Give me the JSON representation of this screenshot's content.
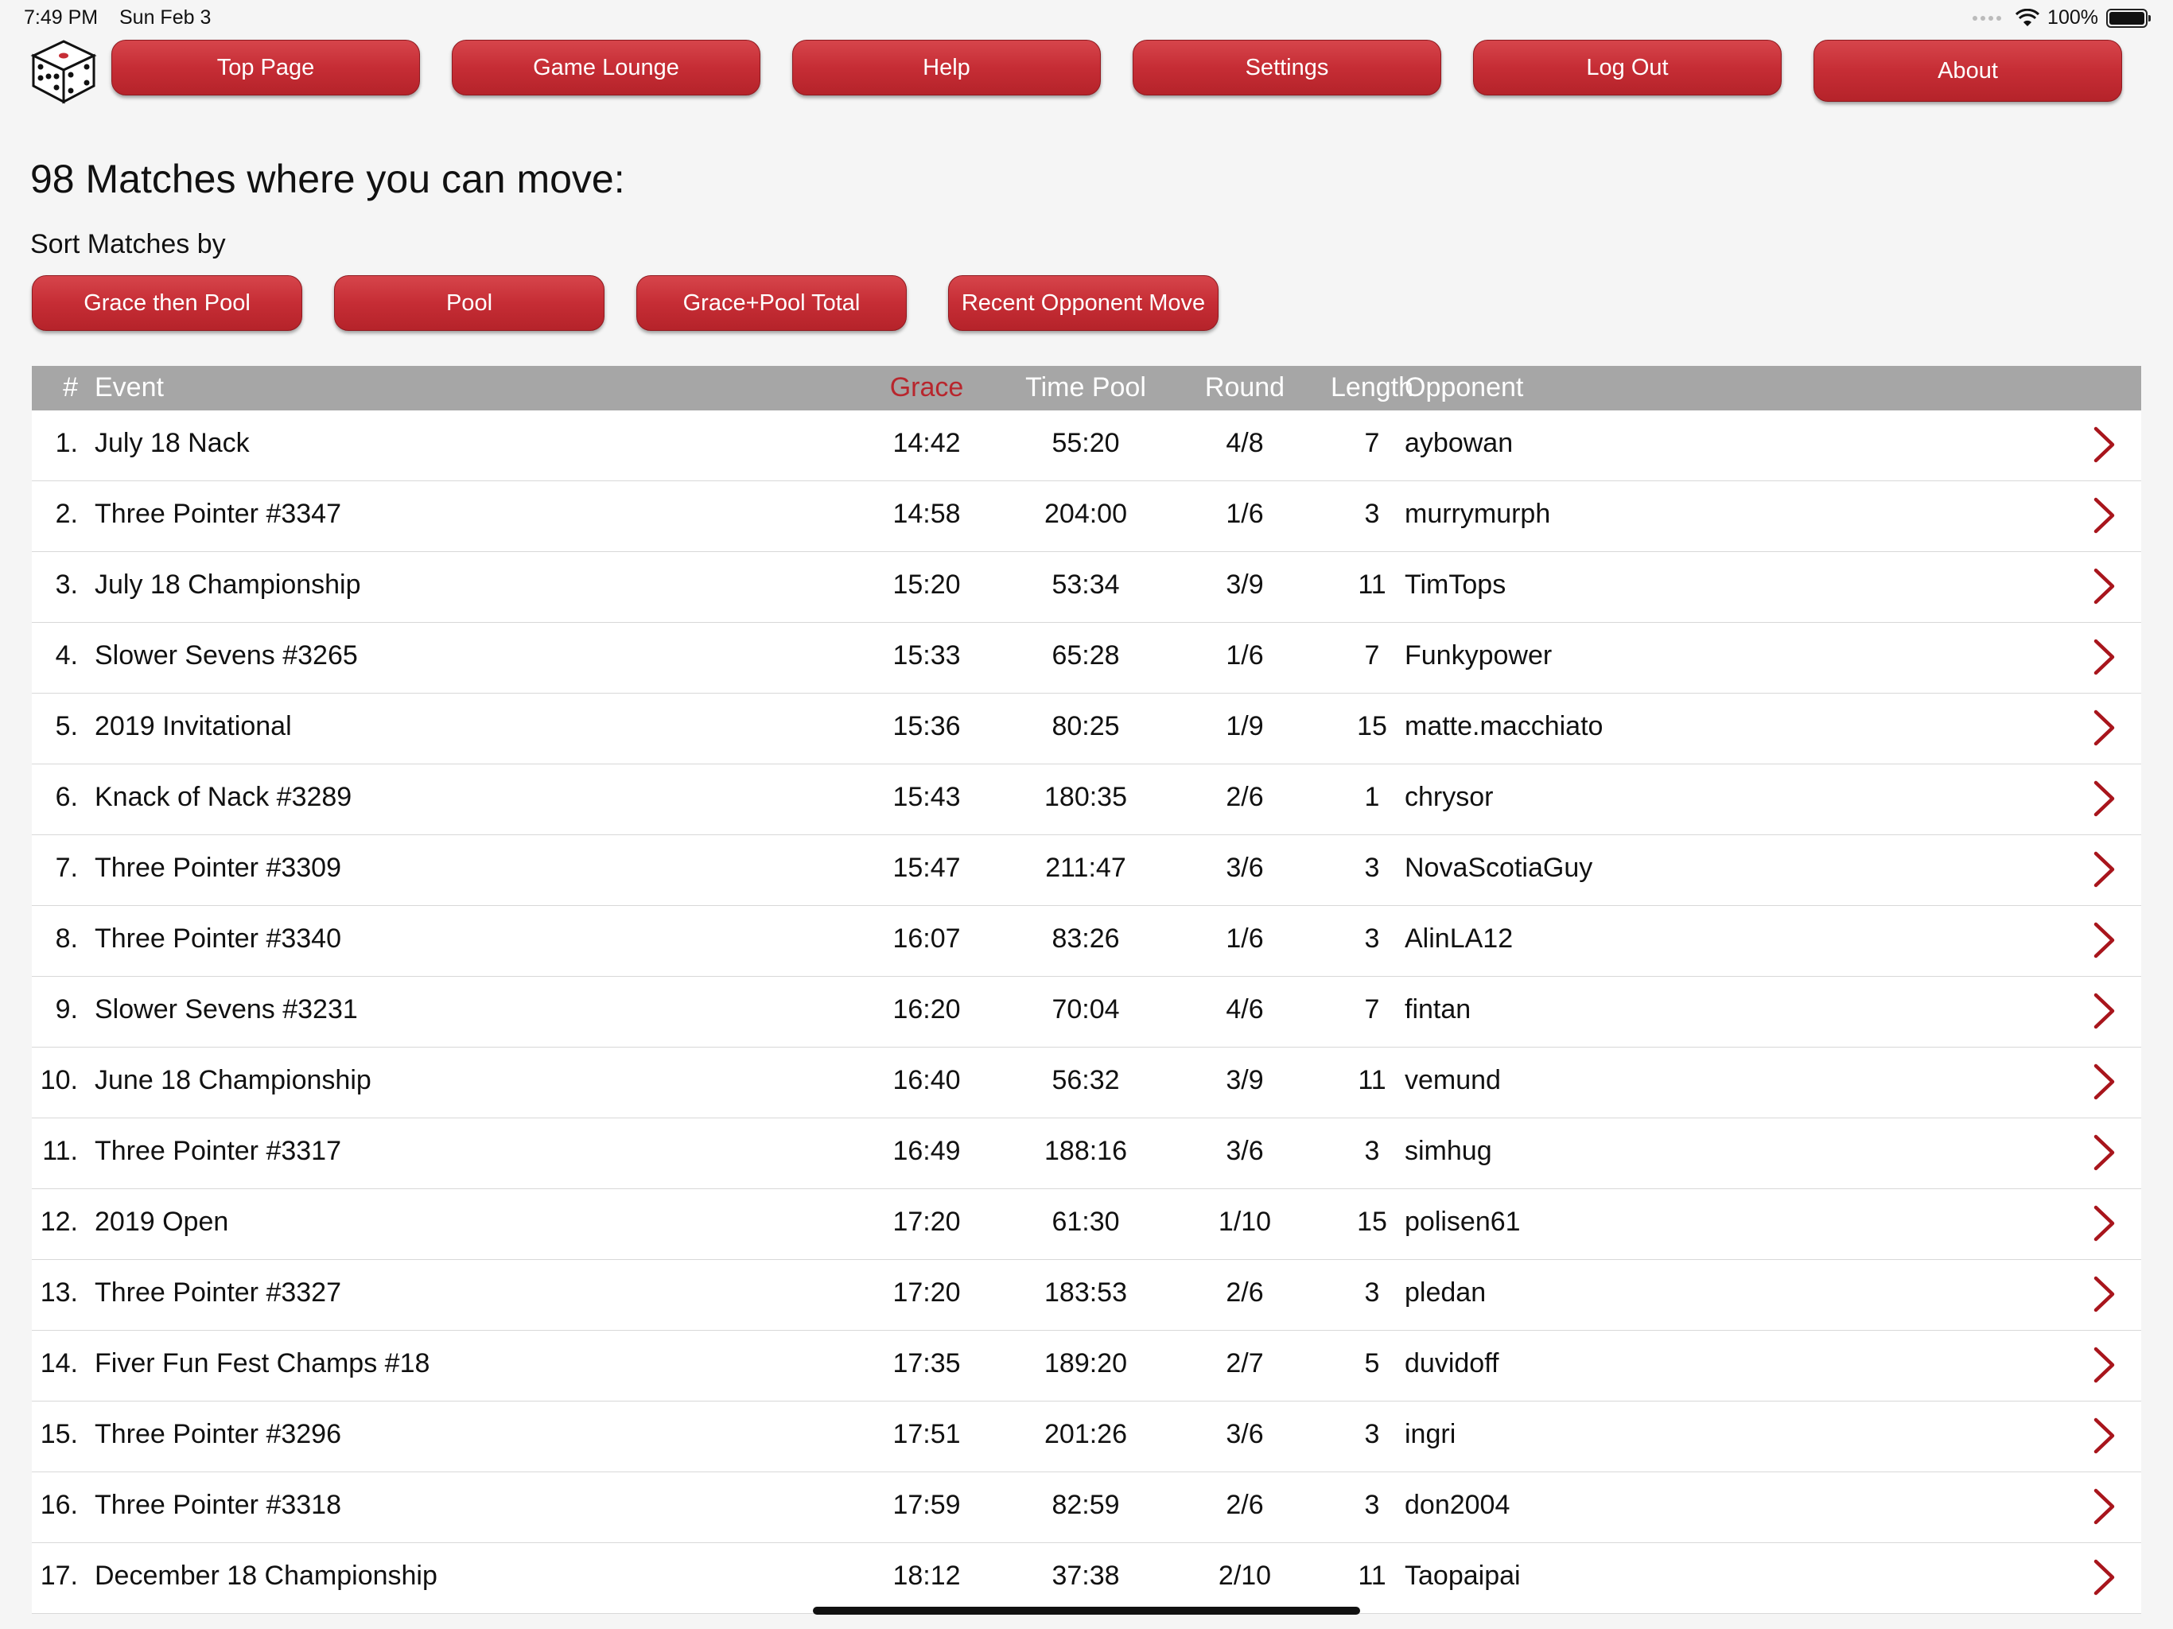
{
  "status": {
    "time": "7:49 PM",
    "date": "Sun Feb 3",
    "battery": "100%"
  },
  "nav": [
    {
      "label": "Top Page"
    },
    {
      "label": "Game Lounge"
    },
    {
      "label": "Help"
    },
    {
      "label": "Settings"
    },
    {
      "label": "Log Out"
    },
    {
      "label": "About"
    }
  ],
  "page": {
    "title": "98 Matches where you can move:",
    "sort_label": "Sort Matches by"
  },
  "sort_buttons": [
    {
      "label": "Grace then Pool"
    },
    {
      "label": "Pool"
    },
    {
      "label": "Grace+Pool Total"
    },
    {
      "label": "Recent Opponent Move"
    }
  ],
  "table": {
    "headers": {
      "num": "#",
      "event": "Event",
      "grace": "Grace",
      "pool": "Time Pool",
      "round": "Round",
      "length": "Length",
      "opponent": "Opponent"
    },
    "rows": [
      {
        "num": "1.",
        "event": "July 18 Nack",
        "grace": "14:42",
        "pool": "55:20",
        "round": "4/8",
        "length": "7",
        "opponent": "aybowan"
      },
      {
        "num": "2.",
        "event": "Three Pointer #3347",
        "grace": "14:58",
        "pool": "204:00",
        "round": "1/6",
        "length": "3",
        "opponent": "murrymurph"
      },
      {
        "num": "3.",
        "event": "July 18 Championship",
        "grace": "15:20",
        "pool": "53:34",
        "round": "3/9",
        "length": "11",
        "opponent": "TimTops"
      },
      {
        "num": "4.",
        "event": "Slower Sevens #3265",
        "grace": "15:33",
        "pool": "65:28",
        "round": "1/6",
        "length": "7",
        "opponent": "Funkypower"
      },
      {
        "num": "5.",
        "event": "2019 Invitational",
        "grace": "15:36",
        "pool": "80:25",
        "round": "1/9",
        "length": "15",
        "opponent": "matte.macchiato"
      },
      {
        "num": "6.",
        "event": "Knack of Nack #3289",
        "grace": "15:43",
        "pool": "180:35",
        "round": "2/6",
        "length": "1",
        "opponent": "chrysor"
      },
      {
        "num": "7.",
        "event": "Three Pointer #3309",
        "grace": "15:47",
        "pool": "211:47",
        "round": "3/6",
        "length": "3",
        "opponent": "NovaScotiaGuy"
      },
      {
        "num": "8.",
        "event": "Three Pointer #3340",
        "grace": "16:07",
        "pool": "83:26",
        "round": "1/6",
        "length": "3",
        "opponent": "AlinLA12"
      },
      {
        "num": "9.",
        "event": "Slower Sevens #3231",
        "grace": "16:20",
        "pool": "70:04",
        "round": "4/6",
        "length": "7",
        "opponent": "fintan"
      },
      {
        "num": "10.",
        "event": "June 18 Championship",
        "grace": "16:40",
        "pool": "56:32",
        "round": "3/9",
        "length": "11",
        "opponent": "vemund"
      },
      {
        "num": "11.",
        "event": "Three Pointer #3317",
        "grace": "16:49",
        "pool": "188:16",
        "round": "3/6",
        "length": "3",
        "opponent": "simhug"
      },
      {
        "num": "12.",
        "event": "2019 Open",
        "grace": "17:20",
        "pool": "61:30",
        "round": "1/10",
        "length": "15",
        "opponent": "polisen61"
      },
      {
        "num": "13.",
        "event": "Three Pointer #3327",
        "grace": "17:20",
        "pool": "183:53",
        "round": "2/6",
        "length": "3",
        "opponent": "pledan"
      },
      {
        "num": "14.",
        "event": "Fiver Fun Fest Champs #18",
        "grace": "17:35",
        "pool": "189:20",
        "round": "2/7",
        "length": "5",
        "opponent": "duvidoff"
      },
      {
        "num": "15.",
        "event": "Three Pointer #3296",
        "grace": "17:51",
        "pool": "201:26",
        "round": "3/6",
        "length": "3",
        "opponent": "ingri"
      },
      {
        "num": "16.",
        "event": "Three Pointer #3318",
        "grace": "17:59",
        "pool": "82:59",
        "round": "2/6",
        "length": "3",
        "opponent": "don2004"
      },
      {
        "num": "17.",
        "event": "December 18 Championship",
        "grace": "18:12",
        "pool": "37:38",
        "round": "2/10",
        "length": "11",
        "opponent": "Taopaipai"
      }
    ]
  },
  "colors": {
    "accent": "#c62d35",
    "header_bg": "#a6a6a6",
    "chevron": "#a8151c"
  },
  "icons": {
    "logo": "dice-icon",
    "row_action": "chevron-right-icon"
  }
}
